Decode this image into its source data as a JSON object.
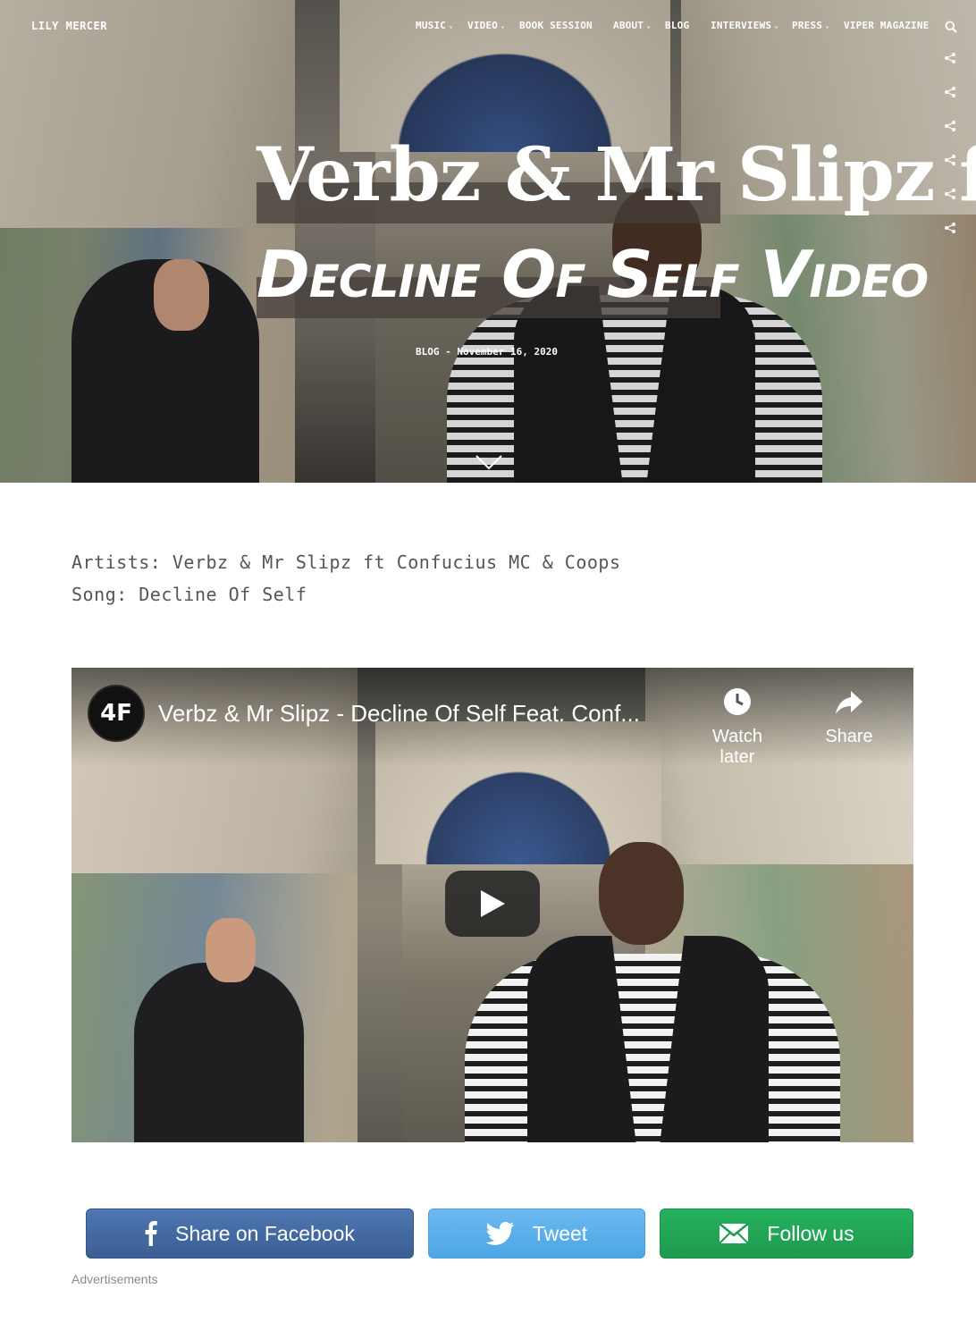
{
  "site": {
    "brand": "LILY MERCER"
  },
  "nav": {
    "items": [
      {
        "label": "MUSIC",
        "dropdown": true
      },
      {
        "label": "VIDEO",
        "dropdown": true
      },
      {
        "label": "BOOK SESSION",
        "dropdown": false
      },
      {
        "label": "ABOUT",
        "dropdown": true
      },
      {
        "label": "BLOG",
        "dropdown": false
      },
      {
        "label": "INTERVIEWS",
        "dropdown": true
      },
      {
        "label": "PRESS",
        "dropdown": true
      },
      {
        "label": "VIPER MAGAZINE",
        "dropdown": false
      }
    ]
  },
  "hero": {
    "title_line_1": "Verbz & Mr Slipz ft",
    "title_line_2": "Decline Of Self Video",
    "meta": "BLOG - November 16, 2020"
  },
  "post": {
    "artists_line": "Artists: Verbz & Mr Slipz ft Confucius MC & Coops",
    "song_line": "Song: Decline Of Self"
  },
  "video": {
    "title": "Verbz & Mr Slipz - Decline Of Self Feat. Conf...",
    "watch_later_label": "Watch later",
    "share_label": "Share",
    "channel_logo_text": "4F"
  },
  "share_buttons": {
    "facebook_label": "Share on Facebook",
    "twitter_label": "Tweet",
    "follow_label": "Follow us"
  },
  "ads_label": "Advertisements",
  "colors": {
    "facebook": "#3b5e94",
    "twitter": "#4ca6e4",
    "follow": "#1d9a4e",
    "body_text": "#555555"
  }
}
